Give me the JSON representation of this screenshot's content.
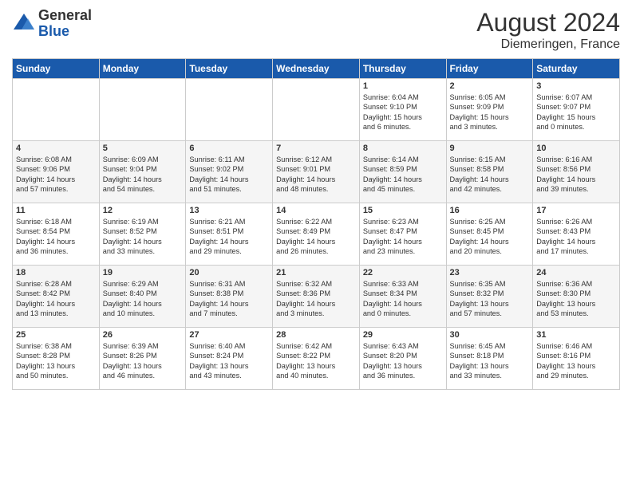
{
  "header": {
    "logo_general": "General",
    "logo_blue": "Blue",
    "month_year": "August 2024",
    "location": "Diemeringen, France"
  },
  "days_of_week": [
    "Sunday",
    "Monday",
    "Tuesday",
    "Wednesday",
    "Thursday",
    "Friday",
    "Saturday"
  ],
  "weeks": [
    [
      {
        "day": "",
        "content": ""
      },
      {
        "day": "",
        "content": ""
      },
      {
        "day": "",
        "content": ""
      },
      {
        "day": "",
        "content": ""
      },
      {
        "day": "1",
        "content": "Sunrise: 6:04 AM\nSunset: 9:10 PM\nDaylight: 15 hours\nand 6 minutes."
      },
      {
        "day": "2",
        "content": "Sunrise: 6:05 AM\nSunset: 9:09 PM\nDaylight: 15 hours\nand 3 minutes."
      },
      {
        "day": "3",
        "content": "Sunrise: 6:07 AM\nSunset: 9:07 PM\nDaylight: 15 hours\nand 0 minutes."
      }
    ],
    [
      {
        "day": "4",
        "content": "Sunrise: 6:08 AM\nSunset: 9:06 PM\nDaylight: 14 hours\nand 57 minutes."
      },
      {
        "day": "5",
        "content": "Sunrise: 6:09 AM\nSunset: 9:04 PM\nDaylight: 14 hours\nand 54 minutes."
      },
      {
        "day": "6",
        "content": "Sunrise: 6:11 AM\nSunset: 9:02 PM\nDaylight: 14 hours\nand 51 minutes."
      },
      {
        "day": "7",
        "content": "Sunrise: 6:12 AM\nSunset: 9:01 PM\nDaylight: 14 hours\nand 48 minutes."
      },
      {
        "day": "8",
        "content": "Sunrise: 6:14 AM\nSunset: 8:59 PM\nDaylight: 14 hours\nand 45 minutes."
      },
      {
        "day": "9",
        "content": "Sunrise: 6:15 AM\nSunset: 8:58 PM\nDaylight: 14 hours\nand 42 minutes."
      },
      {
        "day": "10",
        "content": "Sunrise: 6:16 AM\nSunset: 8:56 PM\nDaylight: 14 hours\nand 39 minutes."
      }
    ],
    [
      {
        "day": "11",
        "content": "Sunrise: 6:18 AM\nSunset: 8:54 PM\nDaylight: 14 hours\nand 36 minutes."
      },
      {
        "day": "12",
        "content": "Sunrise: 6:19 AM\nSunset: 8:52 PM\nDaylight: 14 hours\nand 33 minutes."
      },
      {
        "day": "13",
        "content": "Sunrise: 6:21 AM\nSunset: 8:51 PM\nDaylight: 14 hours\nand 29 minutes."
      },
      {
        "day": "14",
        "content": "Sunrise: 6:22 AM\nSunset: 8:49 PM\nDaylight: 14 hours\nand 26 minutes."
      },
      {
        "day": "15",
        "content": "Sunrise: 6:23 AM\nSunset: 8:47 PM\nDaylight: 14 hours\nand 23 minutes."
      },
      {
        "day": "16",
        "content": "Sunrise: 6:25 AM\nSunset: 8:45 PM\nDaylight: 14 hours\nand 20 minutes."
      },
      {
        "day": "17",
        "content": "Sunrise: 6:26 AM\nSunset: 8:43 PM\nDaylight: 14 hours\nand 17 minutes."
      }
    ],
    [
      {
        "day": "18",
        "content": "Sunrise: 6:28 AM\nSunset: 8:42 PM\nDaylight: 14 hours\nand 13 minutes."
      },
      {
        "day": "19",
        "content": "Sunrise: 6:29 AM\nSunset: 8:40 PM\nDaylight: 14 hours\nand 10 minutes."
      },
      {
        "day": "20",
        "content": "Sunrise: 6:31 AM\nSunset: 8:38 PM\nDaylight: 14 hours\nand 7 minutes."
      },
      {
        "day": "21",
        "content": "Sunrise: 6:32 AM\nSunset: 8:36 PM\nDaylight: 14 hours\nand 3 minutes."
      },
      {
        "day": "22",
        "content": "Sunrise: 6:33 AM\nSunset: 8:34 PM\nDaylight: 14 hours\nand 0 minutes."
      },
      {
        "day": "23",
        "content": "Sunrise: 6:35 AM\nSunset: 8:32 PM\nDaylight: 13 hours\nand 57 minutes."
      },
      {
        "day": "24",
        "content": "Sunrise: 6:36 AM\nSunset: 8:30 PM\nDaylight: 13 hours\nand 53 minutes."
      }
    ],
    [
      {
        "day": "25",
        "content": "Sunrise: 6:38 AM\nSunset: 8:28 PM\nDaylight: 13 hours\nand 50 minutes."
      },
      {
        "day": "26",
        "content": "Sunrise: 6:39 AM\nSunset: 8:26 PM\nDaylight: 13 hours\nand 46 minutes."
      },
      {
        "day": "27",
        "content": "Sunrise: 6:40 AM\nSunset: 8:24 PM\nDaylight: 13 hours\nand 43 minutes."
      },
      {
        "day": "28",
        "content": "Sunrise: 6:42 AM\nSunset: 8:22 PM\nDaylight: 13 hours\nand 40 minutes."
      },
      {
        "day": "29",
        "content": "Sunrise: 6:43 AM\nSunset: 8:20 PM\nDaylight: 13 hours\nand 36 minutes."
      },
      {
        "day": "30",
        "content": "Sunrise: 6:45 AM\nSunset: 8:18 PM\nDaylight: 13 hours\nand 33 minutes."
      },
      {
        "day": "31",
        "content": "Sunrise: 6:46 AM\nSunset: 8:16 PM\nDaylight: 13 hours\nand 29 minutes."
      }
    ]
  ]
}
